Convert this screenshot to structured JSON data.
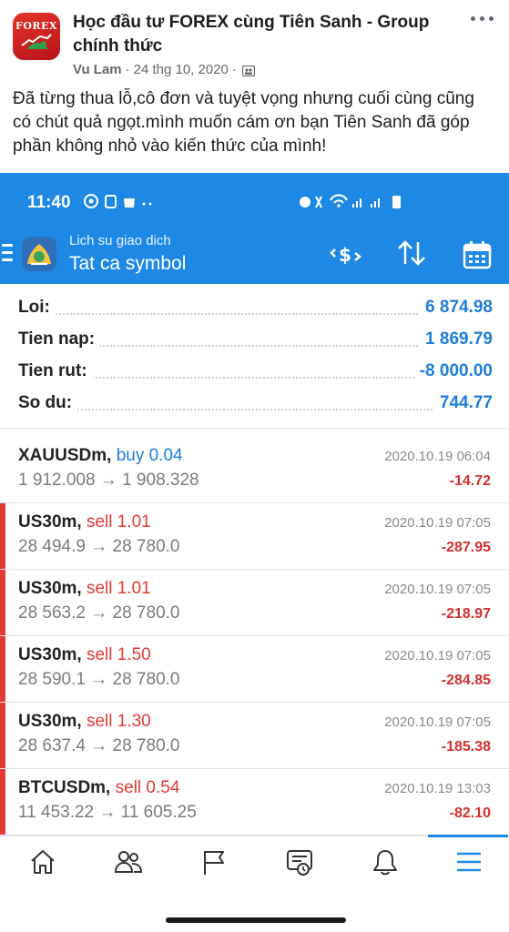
{
  "post": {
    "group_logo_text": "FOREX",
    "group_title": "Học đầu tư FOREX cùng Tiên Sanh - Group chính thức",
    "author": "Vu Lam",
    "separator": "·",
    "date": "24 thg 10, 2020",
    "separator2": "·",
    "body": "Đã từng thua lỗ,cô đơn và tuyệt vọng nhưng cuối cùng cũng có chút quả ngọt.mình muốn cám ơn bạn Tiên Sanh đã góp phần không nhỏ vào kiến thức của mình!"
  },
  "phone": {
    "status_time": "11:40",
    "app_bar": {
      "subtitle": "Lich su giao dich",
      "title": "Tat ca symbol"
    },
    "summary": [
      {
        "label": "Loi:",
        "value": "6 874.98"
      },
      {
        "label": "Tien nap:",
        "value": "1 869.79"
      },
      {
        "label": "Tien rut:",
        "value": "-8 000.00"
      },
      {
        "label": "So du:",
        "value": "744.77"
      }
    ],
    "trades": [
      {
        "symbol": "XAUUSDm,",
        "side": "buy 0.04",
        "prices": "1 912.008 → 1 908.328",
        "date": "2020.10.19 06:04",
        "profit": "-14.72"
      },
      {
        "symbol": "US30m,",
        "side": "sell 1.01",
        "prices": "28 494.9 → 28 780.0",
        "date": "2020.10.19 07:05",
        "profit": "-287.95"
      },
      {
        "symbol": "US30m,",
        "side": "sell 1.01",
        "prices": "28 563.2 → 28 780.0",
        "date": "2020.10.19 07:05",
        "profit": "-218.97"
      },
      {
        "symbol": "US30m,",
        "side": "sell 1.50",
        "prices": "28 590.1 → 28 780.0",
        "date": "2020.10.19 07:05",
        "profit": "-284.85"
      },
      {
        "symbol": "US30m,",
        "side": "sell 1.30",
        "prices": "28 637.4 → 28 780.0",
        "date": "2020.10.19 07:05",
        "profit": "-185.38"
      },
      {
        "symbol": "BTCUSDm,",
        "side": "sell 0.54",
        "prices": "11 453.22 → 11 605.25",
        "date": "2020.10.19 13:03",
        "profit": "-82.10"
      }
    ],
    "bottom_nav": [
      "home-icon",
      "people-icon",
      "flag-icon",
      "feed-icon",
      "bell-icon",
      "menu-icon"
    ],
    "colors": {
      "accent": "#1e88e5",
      "positive": "#1e7ed8",
      "negative": "#d32f2f"
    }
  }
}
